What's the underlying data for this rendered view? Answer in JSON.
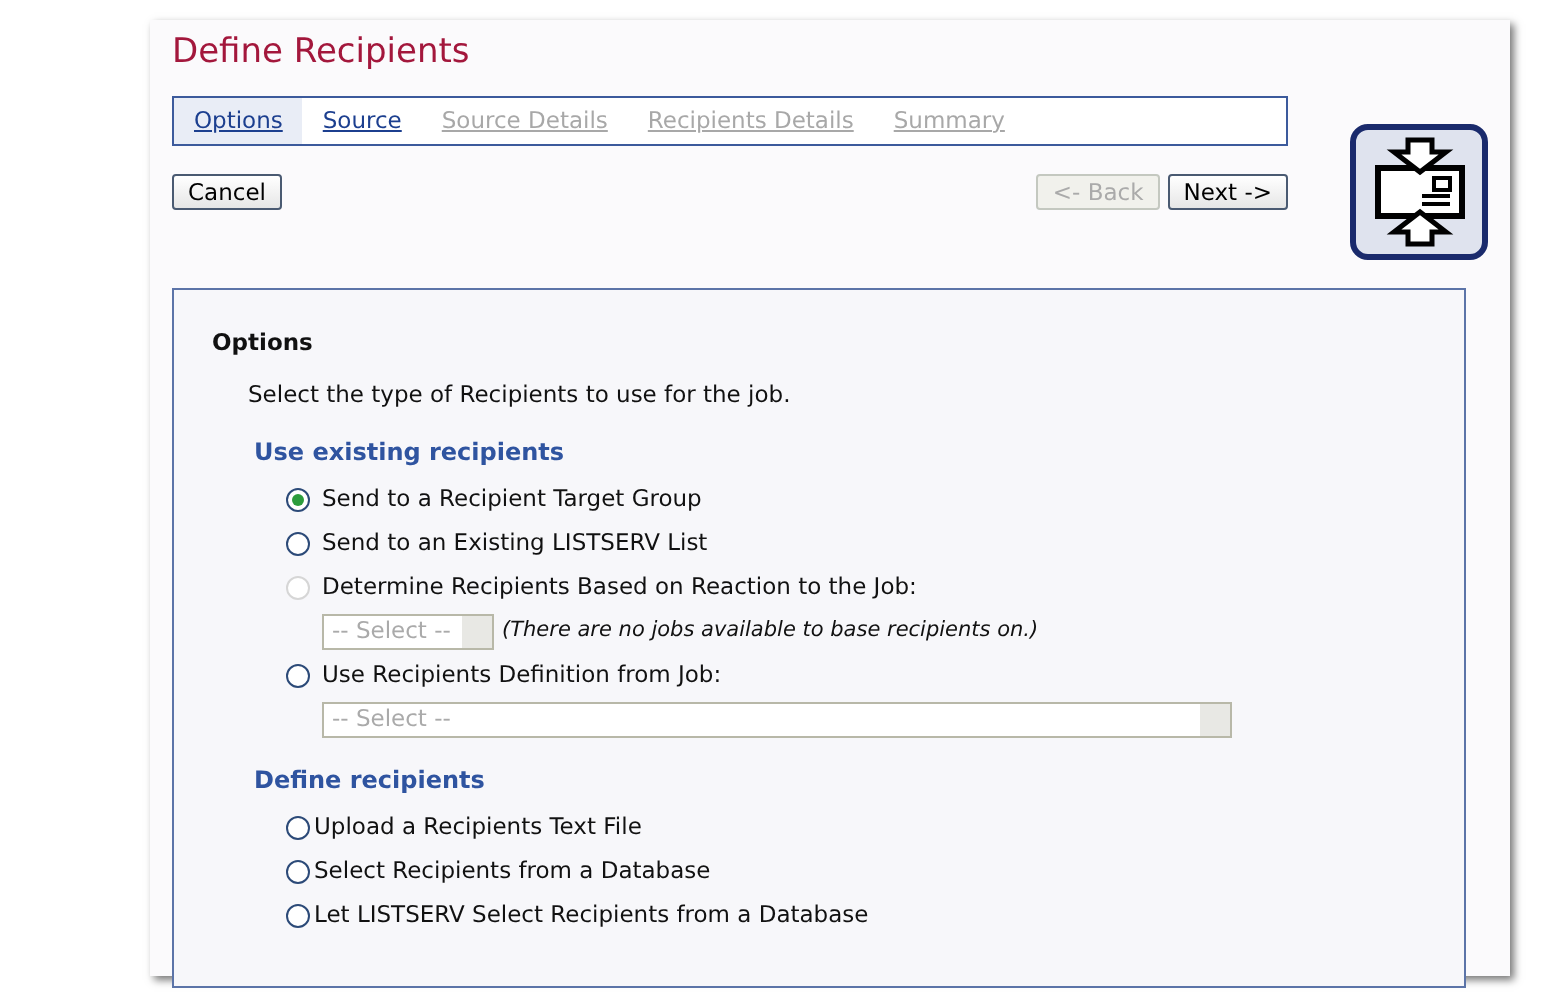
{
  "title": "Define Recipients",
  "tabs": [
    {
      "label": "Options",
      "selected": true,
      "disabled": false
    },
    {
      "label": "Source",
      "selected": false,
      "disabled": false
    },
    {
      "label": "Source Details",
      "selected": false,
      "disabled": true
    },
    {
      "label": "Recipients Details",
      "selected": false,
      "disabled": true
    },
    {
      "label": "Summary",
      "selected": false,
      "disabled": true
    }
  ],
  "buttons": {
    "cancel": {
      "label": "Cancel",
      "disabled": false
    },
    "back": {
      "label": "<- Back",
      "disabled": true
    },
    "next": {
      "label": "Next ->",
      "disabled": false
    }
  },
  "panel": {
    "heading": "Options",
    "intro": "Select the type of Recipients to use for the job.",
    "groups": [
      {
        "heading": "Use existing recipients",
        "options": [
          {
            "label": "Send to a Recipient Target Group",
            "selected": true,
            "disabled": false
          },
          {
            "label": "Send to an Existing LISTSERV List",
            "selected": false,
            "disabled": false
          },
          {
            "label": "Determine Recipients Based on Reaction to the Job:",
            "selected": false,
            "disabled": true,
            "select": {
              "value": "-- Select --",
              "disabled": true,
              "wide": false
            },
            "note": "(There are no jobs available to base recipients on.)"
          },
          {
            "label": "Use Recipients Definition from Job:",
            "selected": false,
            "disabled": false,
            "select": {
              "value": "-- Select --",
              "disabled": true,
              "wide": true
            }
          }
        ]
      },
      {
        "heading": "Define recipients",
        "options": [
          {
            "label": "Upload a Recipients Text File",
            "selected": false,
            "disabled": false
          },
          {
            "label": "Select Recipients from a Database",
            "selected": false,
            "disabled": false
          },
          {
            "label": "Let LISTSERV Select Recipients from a Database",
            "selected": false,
            "disabled": false
          }
        ]
      }
    ]
  }
}
